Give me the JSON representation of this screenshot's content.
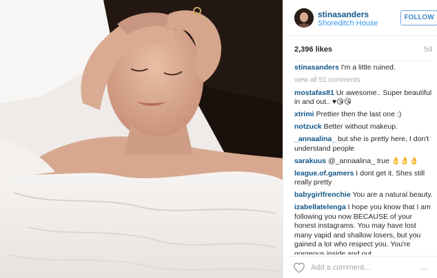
{
  "header": {
    "username": "stinasanders",
    "location": "Shoreditch House",
    "follow_label": "FOLLOW"
  },
  "stats": {
    "likes": "2,396 likes",
    "age": "5d"
  },
  "caption": {
    "user": "stinasanders",
    "text": "I'm a little ruined."
  },
  "view_all": "view all 51 comments",
  "comments": [
    {
      "user": "mostafas81",
      "text": "Ur awesome.. Super beautiful in and out.. ♥😘😘"
    },
    {
      "user": "xtrimi",
      "text": "Prettier then the last one :)"
    },
    {
      "user": "notzuck",
      "text": "Better without makeup."
    },
    {
      "user": "_annaalina_",
      "text": "but she is pretty here, I don't understand people"
    },
    {
      "user": "sarakuus",
      "text": "@_annaalina_ true 👌👌👌"
    },
    {
      "user": "league.of.gamers",
      "text": "I dont get it. Shes still really pretty"
    },
    {
      "user": "babygirlfrenchie",
      "text": "You are a natural beauty."
    },
    {
      "user": "izabellatelenga",
      "text": "I hope you know that I am following you now BECAUSE of your honest instagrams. You may have lost many vapid and shallow losers, but you gained a lot who respect you. You're gorgeous inside and out"
    }
  ],
  "add_comment": {
    "placeholder": "Add a comment...",
    "more": "..."
  },
  "icons": {
    "like": "heart-outline-icon",
    "more": "more-options-icon"
  }
}
